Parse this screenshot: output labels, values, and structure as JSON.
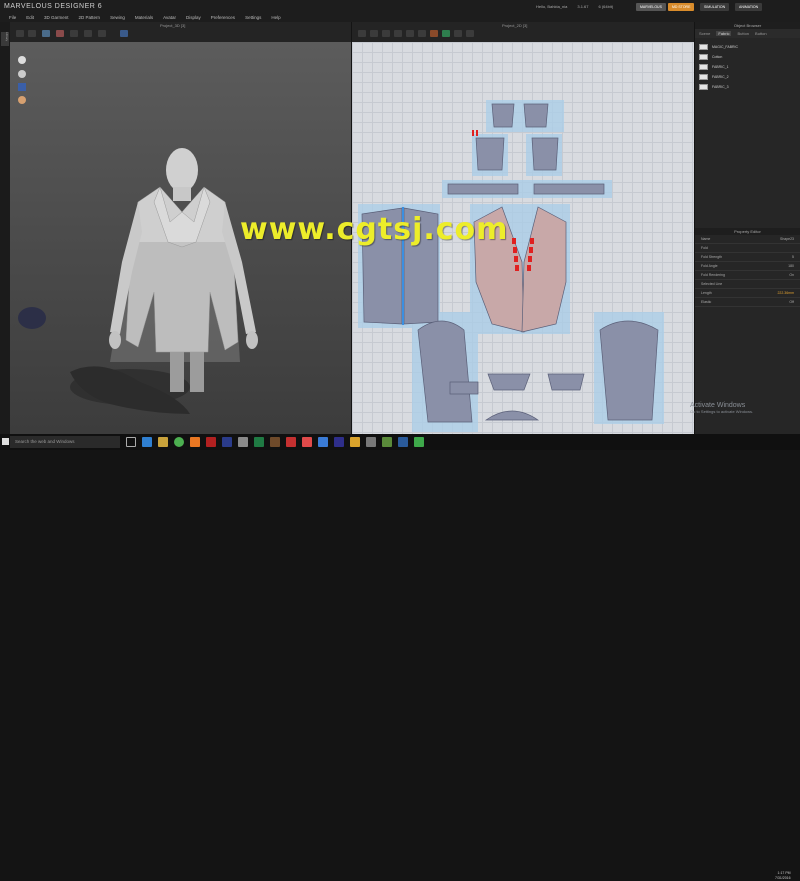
{
  "app": {
    "title": "MARVELOUS DESIGNER 6",
    "user": "Hello, Bahkta_nia",
    "version": "3.1.67",
    "build": "6 (64bit)",
    "btn_marvelous": "MARVELOUS",
    "btn_my_store": "MD STORE",
    "btn_simulation": "SIMULATION",
    "btn_animation": "ANIMATION"
  },
  "menu": [
    "File",
    "Edit",
    "3D Garment",
    "2D Pattern",
    "Sewing",
    "Materials",
    "Avatar",
    "Display",
    "Preferences",
    "Settings",
    "Help"
  ],
  "view3d": {
    "title": "Project_3D [3]"
  },
  "view2d": {
    "title": "Project_2D [3]"
  },
  "side_tabs": [
    "Library"
  ],
  "object_browser": {
    "title": "Object Browser",
    "tabs": [
      "Scene",
      "Fabric",
      "Button",
      "Button"
    ],
    "active_tab": "Fabric",
    "fabrics": [
      "MAGIC_FABRIC",
      "Cotton",
      "FABRIC_1",
      "FABRIC_2",
      "FABRIC_3"
    ]
  },
  "property_editor": {
    "title": "Property Editor",
    "rows": [
      {
        "label": "Name",
        "value": "Shape23"
      },
      {
        "label": "Fold",
        "value": ""
      },
      {
        "label": "Fold Strength",
        "value": "5"
      },
      {
        "label": "Fold Angle",
        "value": "180"
      },
      {
        "label": "Fold Rendering",
        "value": "On"
      },
      {
        "label": "Selected Line",
        "value": ""
      },
      {
        "label": "Length",
        "value": "222.36mm"
      },
      {
        "label": "Elastic",
        "value": "Off"
      }
    ]
  },
  "taskbar": {
    "search_placeholder": "Search the web and Windows",
    "time": "1:17 PM",
    "date": "7/31/2016"
  },
  "activation": {
    "title": "Activate Windows",
    "subtitle": "Go to Settings to activate Windows."
  },
  "watermark": "www.cgtsj.com",
  "colors": {
    "accent_orange": "#d98c2b",
    "pattern_fill": "#8a90a8",
    "pattern_selected": "#a9cde8",
    "seam_red": "#e02020"
  }
}
